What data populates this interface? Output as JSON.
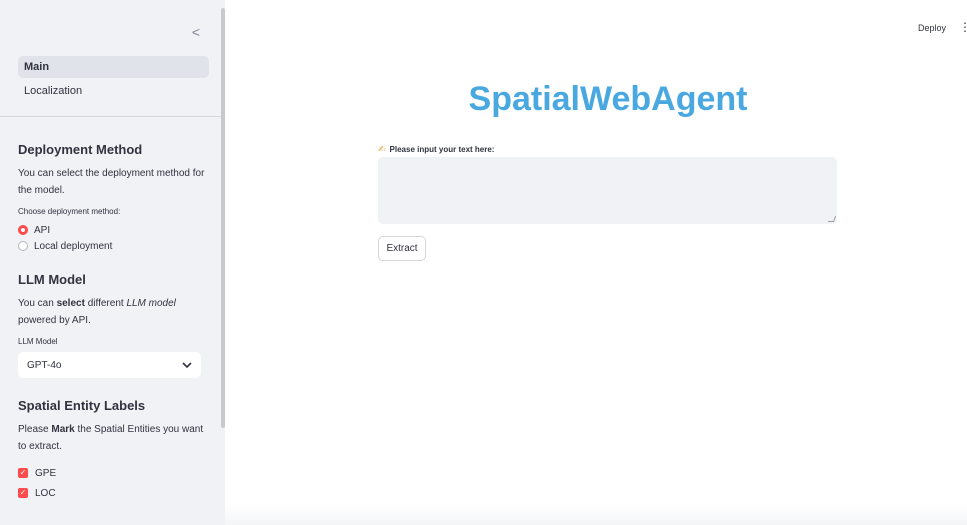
{
  "sidebar": {
    "collapse_glyph": "<",
    "nav": [
      {
        "label": "Main",
        "active": true
      },
      {
        "label": "Localization",
        "active": false
      }
    ],
    "deployment": {
      "title": "Deployment Method",
      "description": "You can select the deployment method for the model.",
      "choose_label": "Choose deployment method:",
      "options": [
        {
          "label": "API",
          "selected": true
        },
        {
          "label": "Local deployment",
          "selected": false
        }
      ]
    },
    "llm": {
      "title": "LLM Model",
      "desc_pre": "You can ",
      "desc_bold": "select",
      "desc_mid": " different ",
      "desc_italic": "LLM model",
      "desc_post": " powered by API.",
      "select_label": "LLM Model",
      "selected": "GPT-4o"
    },
    "entities": {
      "title": "Spatial Entity Labels",
      "desc_pre": "Please ",
      "desc_bold": "Mark",
      "desc_post": " the Spatial Entities you want to extract.",
      "items": [
        {
          "label": "GPE",
          "checked": true
        },
        {
          "label": "LOC",
          "checked": true
        }
      ]
    }
  },
  "header": {
    "deploy_label": "Deploy",
    "menu_glyph": "⋮"
  },
  "main": {
    "title": "SpatialWebAgent",
    "input_label": "Please input your text here:",
    "input_value": "",
    "extract_label": "Extract"
  },
  "colors": {
    "accent": "#ff4b4b",
    "title": "#4aa8e0",
    "sidebar_bg": "#f0f2f6"
  },
  "icons": {
    "pencil": "writing-hand-icon",
    "chevron": "chevron-down-icon",
    "collapse": "chevron-left-icon"
  }
}
